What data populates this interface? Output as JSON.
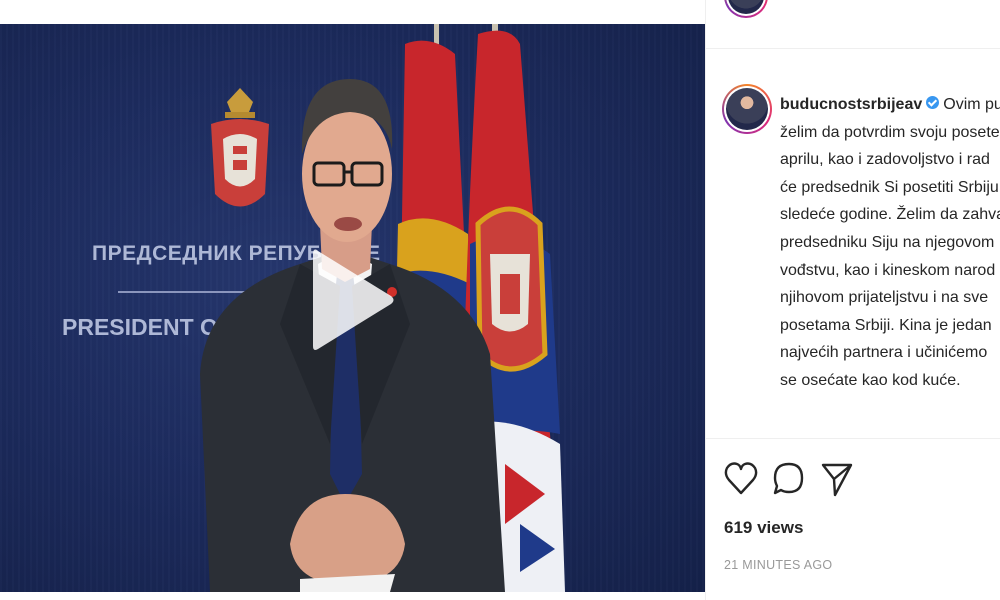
{
  "colors": {
    "video_background": "#1b2a5c",
    "text_primary": "#262626",
    "text_secondary": "#999999",
    "verified_blue": "#3897f0",
    "divider": "#efefef"
  },
  "video": {
    "wall_text_cyrillic": "ПРЕДСЕДНИК РЕПУБЛИКЕ",
    "wall_text_english": "PRESIDENT OF THE",
    "play_icon": "play-icon"
  },
  "post": {
    "username": "buducnostsrbijeav",
    "verified_icon": "verified-badge-icon",
    "caption_lines": [
      "Ovim pu",
      "želim da potvrdim svoju posete",
      "aprilu, kao i zadovoljstvo i rad",
      "će predsednik Si posetiti Srbiju",
      "sledeće godine. Želim da zahva",
      "predsedniku Siju na njegovom",
      "vođstvu, kao i kineskom narod",
      "njihovom prijateljstvu i na sve",
      "posetama Srbiji. Kina je jedan",
      "najvećih partnera i učinićemo",
      "se osećate kao kod kuće."
    ],
    "actions": {
      "like_icon": "heart-icon",
      "comment_icon": "comment-icon",
      "share_icon": "share-icon"
    },
    "views": "619 views",
    "timestamp": "21 MINUTES AGO"
  }
}
